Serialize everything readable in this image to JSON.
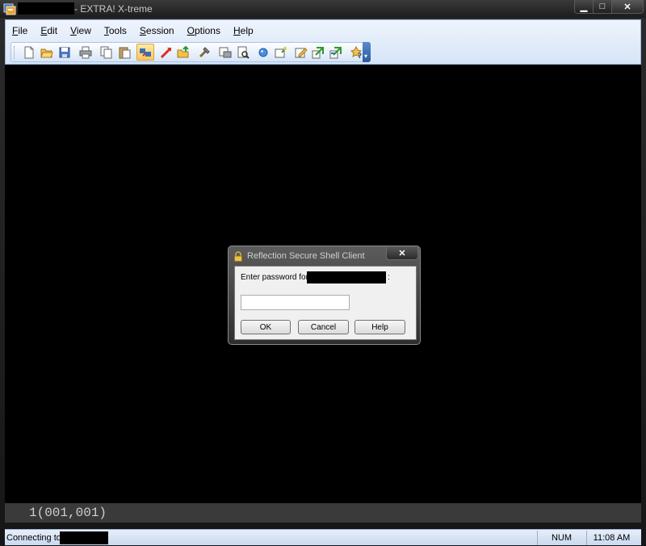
{
  "window": {
    "title": "- EXTRA! X-treme",
    "minimize_glyph": "▁",
    "maximize_glyph": "□",
    "close_glyph": "✕"
  },
  "menu": [
    {
      "label": "File",
      "accel": "F",
      "rest": "ile"
    },
    {
      "label": "Edit",
      "accel": "E",
      "rest": "dit"
    },
    {
      "label": "View",
      "accel": "V",
      "rest": "iew"
    },
    {
      "label": "Tools",
      "accel": "T",
      "rest": "ools"
    },
    {
      "label": "Session",
      "accel": "S",
      "rest": "ession"
    },
    {
      "label": "Options",
      "accel": "O",
      "rest": "ptions"
    },
    {
      "label": "Help",
      "accel": "H",
      "rest": "elp"
    }
  ],
  "toolbar": {
    "icons": [
      "new-icon",
      "open-icon",
      "save-icon",
      "print-icon",
      "copy-icon",
      "paste-icon",
      "connect-icon",
      "disconnect-icon",
      "send-file-icon",
      "tools-icon",
      "print-screen-icon",
      "print-preview-icon",
      "record-icon",
      "macro-icon",
      "edit-icon",
      "transfer-icon",
      "transfer-setup-icon",
      "help-icon"
    ],
    "end_glyph": "▾"
  },
  "terminal": {
    "cursor_position": "1(001,001)"
  },
  "statusbar": {
    "connecting_text": "Connecting to",
    "num": "NUM",
    "time": "11:08 AM"
  },
  "dialog": {
    "title": "Reflection Secure Shell Client",
    "close_glyph": "✕",
    "prompt": "Enter password for",
    "colon": ":",
    "password_value": "",
    "ok_label": "OK",
    "cancel_label": "Cancel",
    "help_label": "Help"
  },
  "colors": {
    "terminal_bg": "#000000",
    "chrome_bg": "#d6e5f7",
    "dialog_frame": "#3c3c3c"
  }
}
